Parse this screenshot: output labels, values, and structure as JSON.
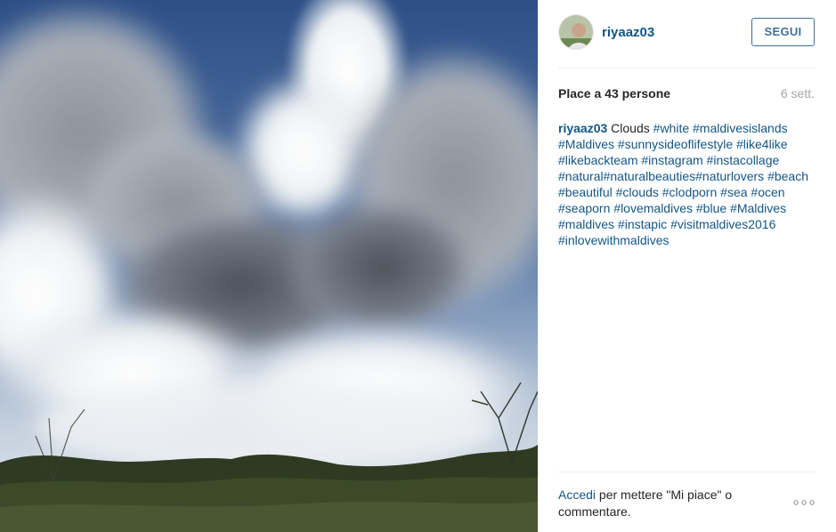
{
  "post": {
    "username": "riyaaz03",
    "follow_label": "SEGUI",
    "likes": "Place a 43 persone",
    "time": "6 sett.",
    "caption_user": "riyaaz03",
    "caption_text": "Clouds",
    "hashtags": [
      "#white",
      "#maldivesislands",
      "#Maldives",
      "#sunnysideoflifestyle",
      "#like4like",
      "#likebackteam",
      "#instagram",
      "#instacollage",
      "#natural",
      "#naturalbeauties",
      "#naturlovers",
      "#beach",
      "#beautiful",
      "#clouds",
      "#clodporn",
      "#sea",
      "#ocen",
      "#seaporn",
      "#lovemaldives",
      "#blue",
      "#Maldives",
      "#maldives",
      "#instapic",
      "#visitmaldives2016",
      "#inlovewithmaldives"
    ]
  },
  "footer": {
    "login_link": "Accedi",
    "login_text": " per mettere \"Mi piace\" o commentare.",
    "more_icon": "ellipsis-icon"
  },
  "colors": {
    "link": "#125688",
    "follow": "#3f729b",
    "muted": "#a5a7aa"
  }
}
